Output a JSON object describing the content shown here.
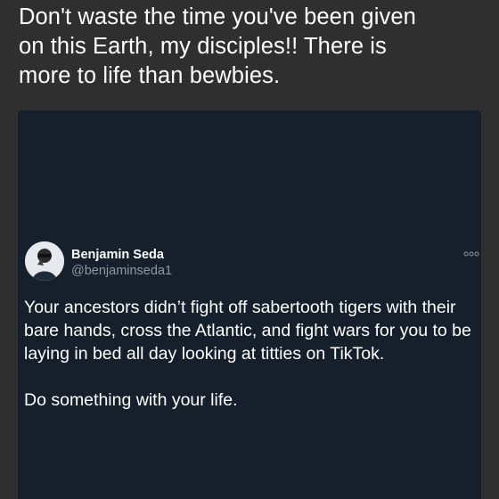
{
  "caption": {
    "text": "Don't waste the time you've been given\non this Earth, my disciples!! There is\nmore to life than bewbies."
  },
  "tweet": {
    "author_name": "Benjamin Seda",
    "author_handle": "@benjaminseda1",
    "paragraphs": [
      "Your ancestors didn’t fight off sabertooth tigers with their bare hands, cross the Atlantic, and fight wars for you to be laying in bed all day looking at titties on TikTok.",
      "Do something with your life."
    ],
    "more_icon": "more-horizontal-icon",
    "avatar_icon": "person-avatar"
  },
  "colors": {
    "page_background": "#2f2f2f",
    "embed_background": "#16202c",
    "text_primary": "#ffffff",
    "text_secondary": "#8b98a5"
  }
}
